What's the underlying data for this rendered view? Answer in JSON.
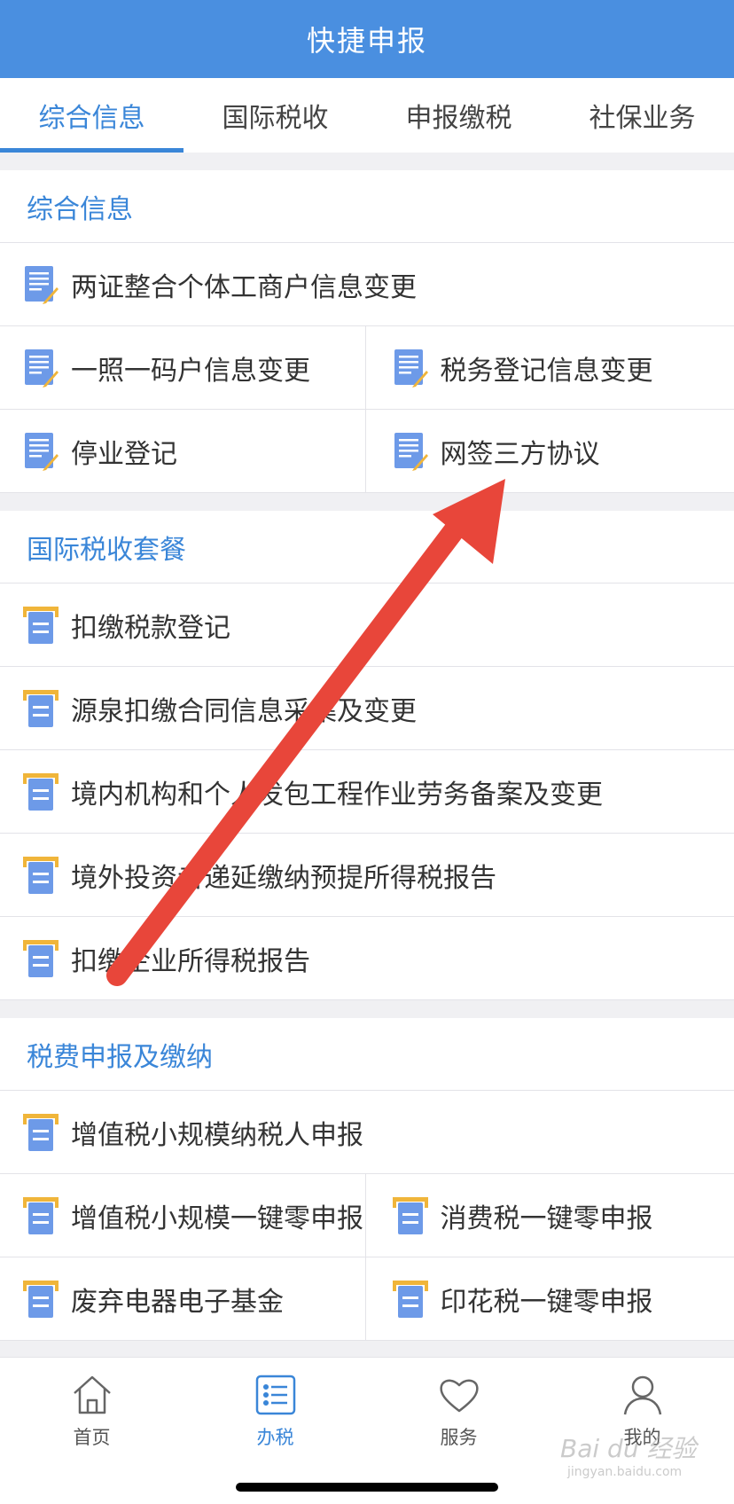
{
  "header": {
    "title": "快捷申报"
  },
  "tabs": [
    {
      "label": "综合信息",
      "active": true
    },
    {
      "label": "国际税收",
      "active": false
    },
    {
      "label": "申报缴税",
      "active": false
    },
    {
      "label": "社保业务",
      "active": false
    }
  ],
  "sections": {
    "general": {
      "title": "综合信息",
      "items": [
        "两证整合个体工商户信息变更",
        "一照一码户信息变更",
        "税务登记信息变更",
        "停业登记",
        "网签三方协议"
      ]
    },
    "international": {
      "title": "国际税收套餐",
      "items": [
        "扣缴税款登记",
        "源泉扣缴合同信息采集及变更",
        "境内机构和个人发包工程作业劳务备案及变更",
        "境外投资者递延缴纳预提所得税报告",
        "扣缴企业所得税报告"
      ]
    },
    "declare": {
      "title": "税费申报及缴纳",
      "items": [
        "增值税小规模纳税人申报",
        "增值税小规模一键零申报",
        "消费税一键零申报",
        "废弃电器电子基金",
        "印花税一键零申报"
      ]
    }
  },
  "tabbar": [
    {
      "label": "首页",
      "icon": "home-icon"
    },
    {
      "label": "办税",
      "icon": "list-icon",
      "active": true
    },
    {
      "label": "服务",
      "icon": "heart-icon"
    },
    {
      "label": "我的",
      "icon": "user-icon"
    }
  ],
  "watermark": {
    "main": "Bai du 经验",
    "sub": "jingyan.baidu.com"
  },
  "colors": {
    "primary": "#4a8fe0",
    "accent": "#3a86d8",
    "annotation_arrow": "#e8463a"
  }
}
